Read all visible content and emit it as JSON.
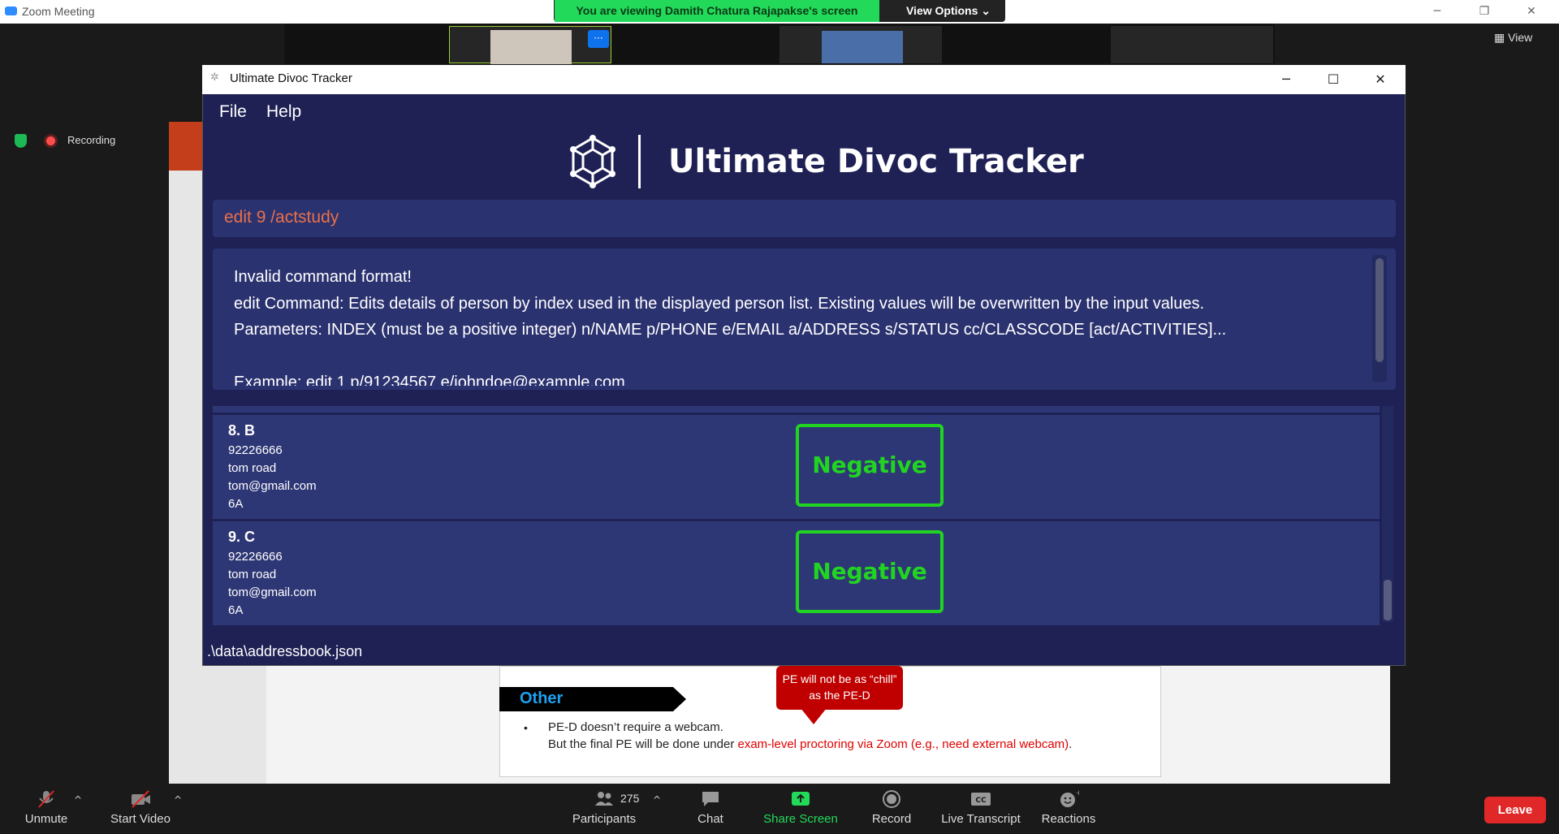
{
  "zoom": {
    "window_title": "Zoom Meeting",
    "viewing_banner": "You are viewing Damith Chatura Rajapakse's screen",
    "view_options": "View Options ⌄",
    "recording": "Recording",
    "view_label": "View",
    "toolbar": {
      "unmute": "Unmute",
      "start_video": "Start Video",
      "participants": "Participants",
      "participants_count": "275",
      "chat": "Chat",
      "share_screen": "Share Screen",
      "record": "Record",
      "live_transcript": "Live Transcript",
      "reactions": "Reactions",
      "leave": "Leave"
    }
  },
  "slide": {
    "section_title": "Other",
    "callout": "PE will not be as “chill” as the PE-D",
    "bullet": "•",
    "line1": "PE-D doesn’t require a webcam.",
    "line2_prefix": "But the final PE will be done under ",
    "line2_red": "exam-level proctoring via Zoom (e.g., need external webcam)",
    "line2_suffix": "."
  },
  "app": {
    "title": "Ultimate Divoc Tracker",
    "menu": {
      "file": "File",
      "help": "Help"
    },
    "logo_text": "Ultimate Divoc Tracker",
    "command_value": "edit 9 /actstudy",
    "result": "Invalid command format!\nedit Command: Edits details of person by index used in the displayed person list. Existing values will be overwritten by the input values.\nParameters: INDEX (must be a positive integer) n/NAME p/PHONE e/EMAIL a/ADDRESS s/STATUS cc/CLASSCODE [act/ACTIVITIES]...\n\nExample: edit 1 p/91234567 e/johndoe@example.com",
    "persons": [
      {
        "header": "8.  B",
        "phone": "92226666",
        "address": "tom road",
        "email": "tom@gmail.com",
        "classcode": "6A",
        "status": "Negative"
      },
      {
        "header": "9.  C",
        "phone": "92226666",
        "address": "tom road",
        "email": "tom@gmail.com",
        "classcode": "6A",
        "status": "Negative"
      }
    ],
    "status_bar_path": ".\\data\\addressbook.json"
  },
  "colors": {
    "app_bg": "#1f2155",
    "panel_bg": "#2b3270",
    "card_bg": "#2e3775",
    "command_text": "#e8714a",
    "status_green": "#22d422",
    "zoom_green": "#23d959",
    "leave_red": "#e02828"
  }
}
